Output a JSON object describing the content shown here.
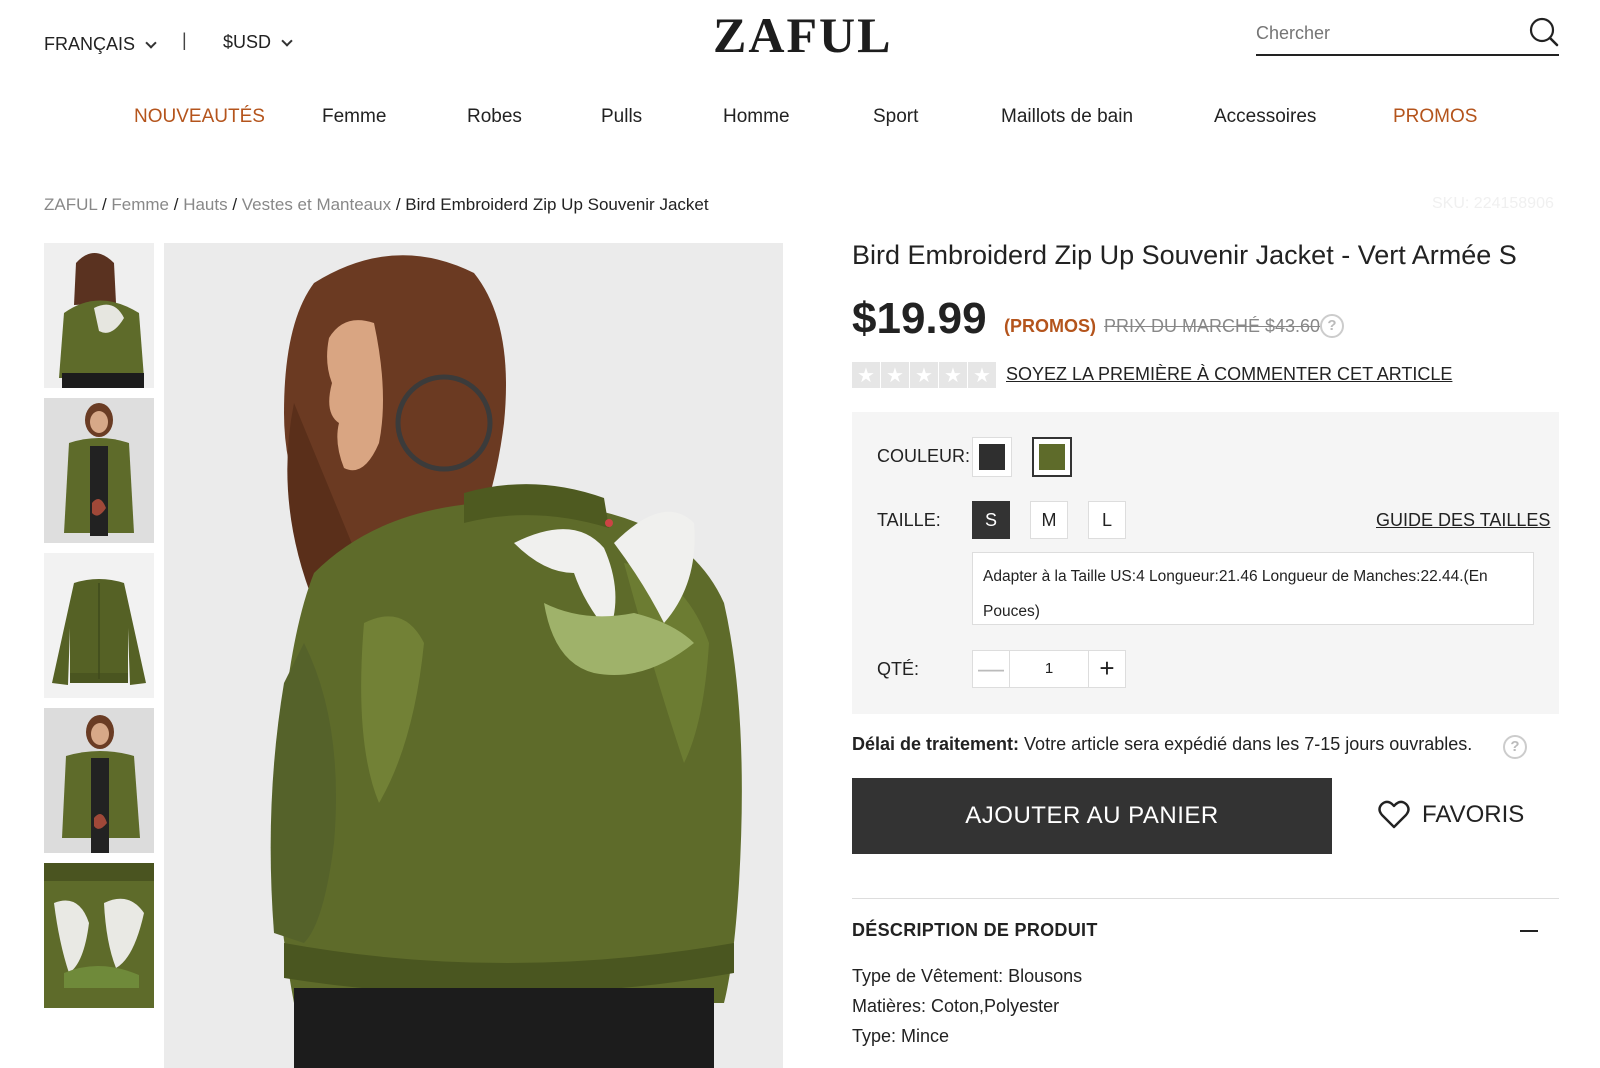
{
  "header": {
    "language": "FRANÇAIS",
    "separator": "|",
    "currency": "$USD",
    "logo": "ZAFUL",
    "search_placeholder": "Chercher"
  },
  "nav": [
    {
      "label": "NOUVEAUTÉS",
      "highlight": true
    },
    {
      "label": "Femme",
      "highlight": false
    },
    {
      "label": "Robes",
      "highlight": false
    },
    {
      "label": "Pulls",
      "highlight": false
    },
    {
      "label": "Homme",
      "highlight": false
    },
    {
      "label": "Sport",
      "highlight": false
    },
    {
      "label": "Maillots de bain",
      "highlight": false
    },
    {
      "label": "Accessoires",
      "highlight": false
    },
    {
      "label": "PROMOS",
      "highlight": true
    }
  ],
  "breadcrumb": {
    "items": [
      "ZAFUL",
      "Femme",
      "Hauts",
      "Vestes et Manteaux"
    ],
    "current": "Bird Embroiderd Zip Up Souvenir Jacket",
    "sku": "SKU: 224158906"
  },
  "product": {
    "title": "Bird Embroiderd Zip Up Souvenir Jacket - Vert Armée S",
    "price": "$19.99",
    "promo_tag": "(PROMOS)",
    "market_price": "PRIX DU MARCHÉ $43.60",
    "help_glyph": "?",
    "rating": 0,
    "review_link": "SOYEZ LA PREMIÈRE À COMMENTER CET ARTICLE",
    "color_label": "COULEUR:",
    "colors": [
      {
        "name": "black",
        "hex": "#2f2f2f",
        "selected": false
      },
      {
        "name": "army green",
        "hex": "#5e6b2a",
        "selected": true
      }
    ],
    "size_label": "TAILLE:",
    "sizes": [
      {
        "label": "S",
        "selected": true
      },
      {
        "label": "M",
        "selected": false
      },
      {
        "label": "L",
        "selected": false
      }
    ],
    "size_guide": "GUIDE DES TAILLES",
    "size_info": "Adapter à la Taille US:4   Longueur:21.46   Longueur de Manches:22.44.(En Pouces)",
    "qty_label": "QTÉ:",
    "qty_value": "1",
    "qty_minus": "—",
    "qty_plus": "+",
    "delay_label": "Délai de traitement:",
    "delay_text": " Votre article sera expédié dans les 7-15 jours ouvrables.",
    "add_to_cart": "AJOUTER AU PANIER",
    "favorites": "FAVORIS",
    "description_title": "DÉSCRIPTION DE PRODUIT",
    "description_lines": [
      "Type de Vêtement: Blousons",
      "Matières: Coton,Polyester",
      "Type: Mince"
    ]
  },
  "colors": {
    "accent": "#b4541c",
    "jacket": "#5e6b2a",
    "button": "#333333"
  }
}
